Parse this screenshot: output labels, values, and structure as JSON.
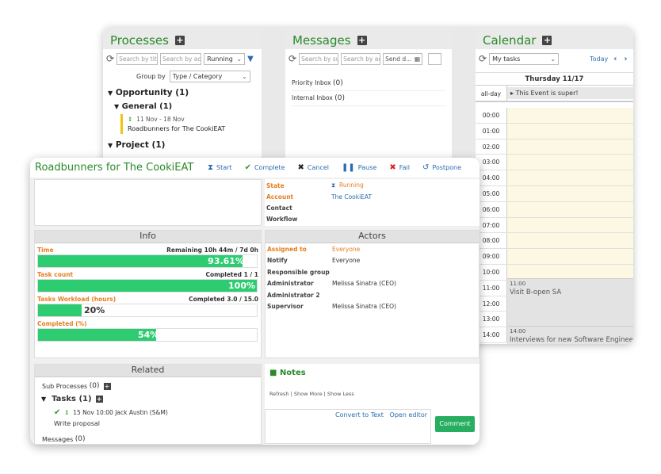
{
  "processes": {
    "title": "Processes",
    "search1": "Search by titl",
    "search2": "Search by acc",
    "status": "Running",
    "group_by_label": "Group by",
    "group_by_value": "Type / Category",
    "opportunity": "Opportunity (1)",
    "general": "General (1)",
    "item_dates": "11 Nov  -  18 Nov",
    "item_name": "Roadbunners for The CookiEAT",
    "project": "Project (1)"
  },
  "messages": {
    "title": "Messages",
    "search1": "Search by su",
    "search2": "Search by ac",
    "send_date": "Send d...",
    "priority_label": "Priority Inbox",
    "priority_count": "(0)",
    "internal_label": "Internal Inbox",
    "internal_count": "(0)"
  },
  "calendar": {
    "title": "Calendar",
    "select": "My tasks",
    "today": "Today",
    "day_header": "Thursday 11/17",
    "allday_label": "all-day",
    "allday_event": "This Event is super!",
    "hours": [
      "00:00",
      "01:00",
      "02:00",
      "03:00",
      "04:00",
      "05:00",
      "06:00",
      "07:00",
      "08:00",
      "09:00",
      "10:00",
      "11:00",
      "12:00",
      "13:00",
      "14:00"
    ],
    "event1_time": "11:00",
    "event1_title": "Visit B-open SA",
    "event2_time": "14:00",
    "event2_title": "Interviews for new Software Engineer"
  },
  "detail": {
    "title": "Roadbunners for The CookiEAT",
    "actions": {
      "start": "Start",
      "complete": "Complete",
      "cancel": "Cancel",
      "pause": "Pause",
      "fail": "Fail",
      "postpone": "Postpone"
    },
    "state": {
      "state_k": "State",
      "state_v": "Running",
      "account_k": "Account",
      "account_v": "The CookiEAT",
      "contact_k": "Contact",
      "workflow_k": "Workflow"
    },
    "info": {
      "title": "Info",
      "time_label": "Time",
      "time_right": "Remaining 10h 44m / 7d 0h",
      "time_pct": "93.61%",
      "time_fill": 0.9361,
      "taskcount_label": "Task count",
      "taskcount_right": "Completed 1 / 1",
      "taskcount_pct": "100%",
      "taskcount_fill": 1.0,
      "workload_label": "Tasks Workload (hours)",
      "workload_right": "Completed 3.0 / 15.0",
      "workload_pct": "20%",
      "workload_fill": 0.2,
      "completed_label": "Completed (%)",
      "completed_pct": "54%",
      "completed_fill": 0.54
    },
    "actors": {
      "title": "Actors",
      "assigned_k": "Assigned to",
      "assigned_v": "Everyone",
      "notify_k": "Notify",
      "notify_v": "Everyone",
      "resp_k": "Responsible group",
      "admin_k": "Administrator",
      "admin_v": "Melissa Sinatra (CEO)",
      "admin2_k": "Administrator 2",
      "sup_k": "Supervisor",
      "sup_v": "Melissa Sinatra (CEO)"
    },
    "related": {
      "title": "Related",
      "sub_label": "Sub Processes",
      "sub_count": "(0)",
      "tasks_label": "Tasks",
      "tasks_count": "(1)",
      "task_meta": "15 Nov  10:00 Jack Austin (S&M)",
      "task_name": "Write proposal",
      "messages_label": "Messages",
      "messages_count": "(0)"
    },
    "notes": {
      "title": "Notes",
      "refresh": "Refresh",
      "show_more": "Show More",
      "show_less": "Show Less",
      "convert": "Convert to Text",
      "open_editor": "Open editor",
      "comment": "Comment"
    }
  }
}
